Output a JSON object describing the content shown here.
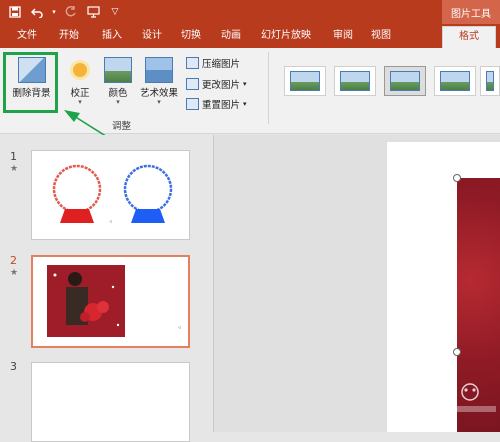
{
  "qat": {
    "save_icon": "save-icon",
    "undo_icon": "undo-icon",
    "redo_icon": "redo-icon",
    "present_icon": "present-icon",
    "customize_icon": "customize-icon"
  },
  "context_tab_group": "图片工具",
  "tabs": [
    "文件",
    "开始",
    "插入",
    "设计",
    "切换",
    "动画",
    "幻灯片放映",
    "审阅",
    "视图",
    "格式"
  ],
  "active_tab": "格式",
  "ribbon": {
    "remove_background": "删除背景",
    "corrections": "校正",
    "color": "颜色",
    "artistic_effects": "艺术效果",
    "compress_pictures": "压缩图片",
    "change_picture": "更改图片",
    "reset_picture": "重置图片",
    "group_adjust": "调整"
  },
  "slides": [
    {
      "number": "1",
      "has_animation": "★"
    },
    {
      "number": "2",
      "has_animation": "★"
    },
    {
      "number": "3",
      "has_animation": ""
    }
  ],
  "colors": {
    "accent": "#b83b1e",
    "highlight": "#1fa24a",
    "selected_thumb": "#e3805f"
  }
}
